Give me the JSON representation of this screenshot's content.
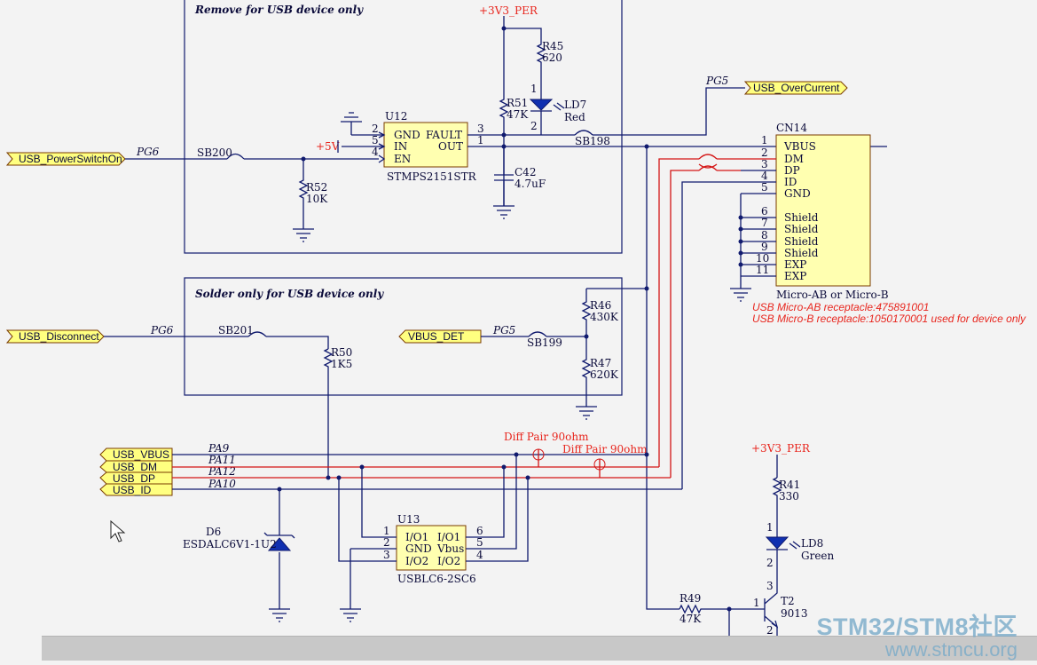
{
  "sections": {
    "remove_label": "Remove for USB device only",
    "solder_label": "Solder only for USB device only"
  },
  "ports": {
    "power_switch": "USB_PowerSwitchOn",
    "over_current": "USB_OverCurrent",
    "disconnect": "USB_Disconnect",
    "vbus_det": "VBUS_DET",
    "usb_vbus": "USB_VBUS",
    "usb_dm": "USB_DM",
    "usb_dp": "USB_DP",
    "usb_id": "USB_ID"
  },
  "nets": {
    "pg6_a": "PG6",
    "pg6_b": "PG6",
    "pg5_a": "PG5",
    "pg5_b": "PG5",
    "pa9": "PA9",
    "pa11": "PA11",
    "pa12": "PA12",
    "pa10": "PA10",
    "v3v3_a": "+3V3_PER",
    "v3v3_b": "+3V3_PER",
    "v5": "+5V"
  },
  "u12": {
    "ref": "U12",
    "part": "STMPS2151STR",
    "pins": {
      "gnd": "GND",
      "in": "IN",
      "en": "EN",
      "fault": "FAULT",
      "out": "OUT"
    },
    "pin_numbers": {
      "p2": "2",
      "p5": "5",
      "p4": "4",
      "p3": "3",
      "p1": "1"
    }
  },
  "cn14": {
    "ref": "CN14",
    "part": "Micro-AB or Micro-B",
    "pins": [
      "VBUS",
      "DM",
      "DP",
      "ID",
      "GND",
      "Shield",
      "Shield",
      "Shield",
      "Shield",
      "EXP",
      "EXP"
    ],
    "numbers": [
      "1",
      "2",
      "3",
      "4",
      "5",
      "6",
      "7",
      "8",
      "9",
      "10",
      "11"
    ],
    "note1": "USB Micro-AB receptacle:475891001",
    "note2": "USB Micro-B receptacle:1050170001 used for device only"
  },
  "u13": {
    "ref": "U13",
    "part": "USBLC6-2SC6",
    "pins": {
      "io1_l": "I/O1",
      "gnd": "GND",
      "io2_l": "I/O2",
      "io1_r": "I/O1",
      "vbus": "Vbus",
      "io2_r": "I/O2"
    },
    "pin_numbers": {
      "p1": "1",
      "p2": "2",
      "p3": "3",
      "p6": "6",
      "p5": "5",
      "p4": "4"
    }
  },
  "parts": {
    "r45": {
      "ref": "R45",
      "value": "620"
    },
    "r51": {
      "ref": "R51",
      "value": "47K"
    },
    "ld7": {
      "ref": "LD7",
      "value": "Red",
      "pin1": "1",
      "pin2": "2"
    },
    "r52": {
      "ref": "R52",
      "value": "10K"
    },
    "c42": {
      "ref": "C42",
      "value": "4.7uF"
    },
    "r46": {
      "ref": "R46",
      "value": "430K"
    },
    "r47": {
      "ref": "R47",
      "value": "620K"
    },
    "r50": {
      "ref": "R50",
      "value": "1K5"
    },
    "d6": {
      "ref": "D6",
      "value": "ESDALC6V1-1U2"
    },
    "r41": {
      "ref": "R41",
      "value": "330"
    },
    "ld8": {
      "ref": "LD8",
      "value": "Green",
      "pin1": "1",
      "pin2": "2"
    },
    "r49": {
      "ref": "R49",
      "value": "47K"
    },
    "t2": {
      "ref": "T2",
      "value": "9013",
      "pin1": "1",
      "pin2": "2",
      "pin3": "3"
    }
  },
  "jumpers": {
    "sb200": "SB200",
    "sb198": "SB198",
    "sb201": "SB201",
    "sb199": "SB199"
  },
  "diff_pairs": [
    "Diff Pair 90ohm",
    "Diff Pair 90ohm"
  ],
  "watermark": {
    "line1": "STM32/STM8社区",
    "line2": "www.stmcu.org"
  }
}
